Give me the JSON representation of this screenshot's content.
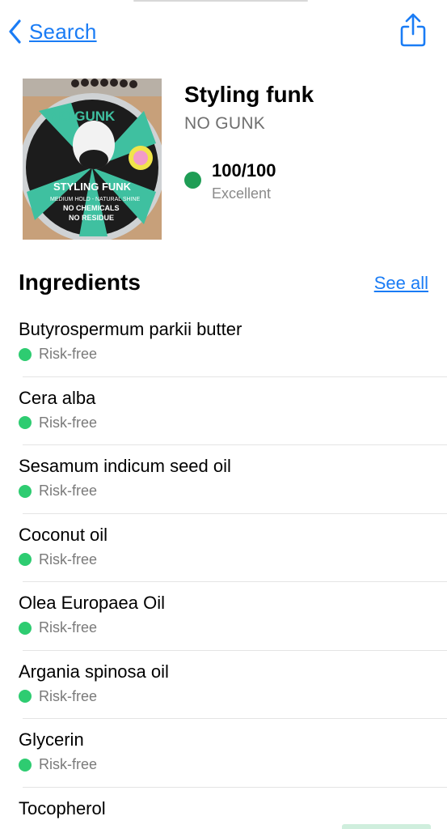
{
  "nav": {
    "back_label": "Search",
    "back_icon": "chevron-left-icon",
    "share_icon": "share-icon"
  },
  "product": {
    "name": "Styling funk",
    "brand": "NO GUNK",
    "score": "100/100",
    "score_label": "Excellent",
    "score_color": "#1f9d55",
    "image_text": {
      "brand": "NO GUNK",
      "product": "STYLING FUNK",
      "tagline": "MEDIUM HOLD - NATURAL SHINE",
      "claim1": "NO CHEMICALS",
      "claim2": "NO RESIDUE"
    }
  },
  "ingredients_section": {
    "title": "Ingredients",
    "see_all": "See all"
  },
  "ingredients": [
    {
      "name": "Butyrospermum parkii butter",
      "risk": "Risk-free"
    },
    {
      "name": "Cera alba",
      "risk": "Risk-free"
    },
    {
      "name": "Sesamum indicum seed oil",
      "risk": "Risk-free"
    },
    {
      "name": "Coconut oil",
      "risk": "Risk-free"
    },
    {
      "name": "Olea Europaea Oil",
      "risk": "Risk-free"
    },
    {
      "name": "Argania spinosa oil",
      "risk": "Risk-free"
    },
    {
      "name": "Glycerin",
      "risk": "Risk-free"
    },
    {
      "name": "Tocopherol"
    }
  ],
  "colors": {
    "accent": "#1a7cf5",
    "risk_free": "#2ecc71"
  }
}
